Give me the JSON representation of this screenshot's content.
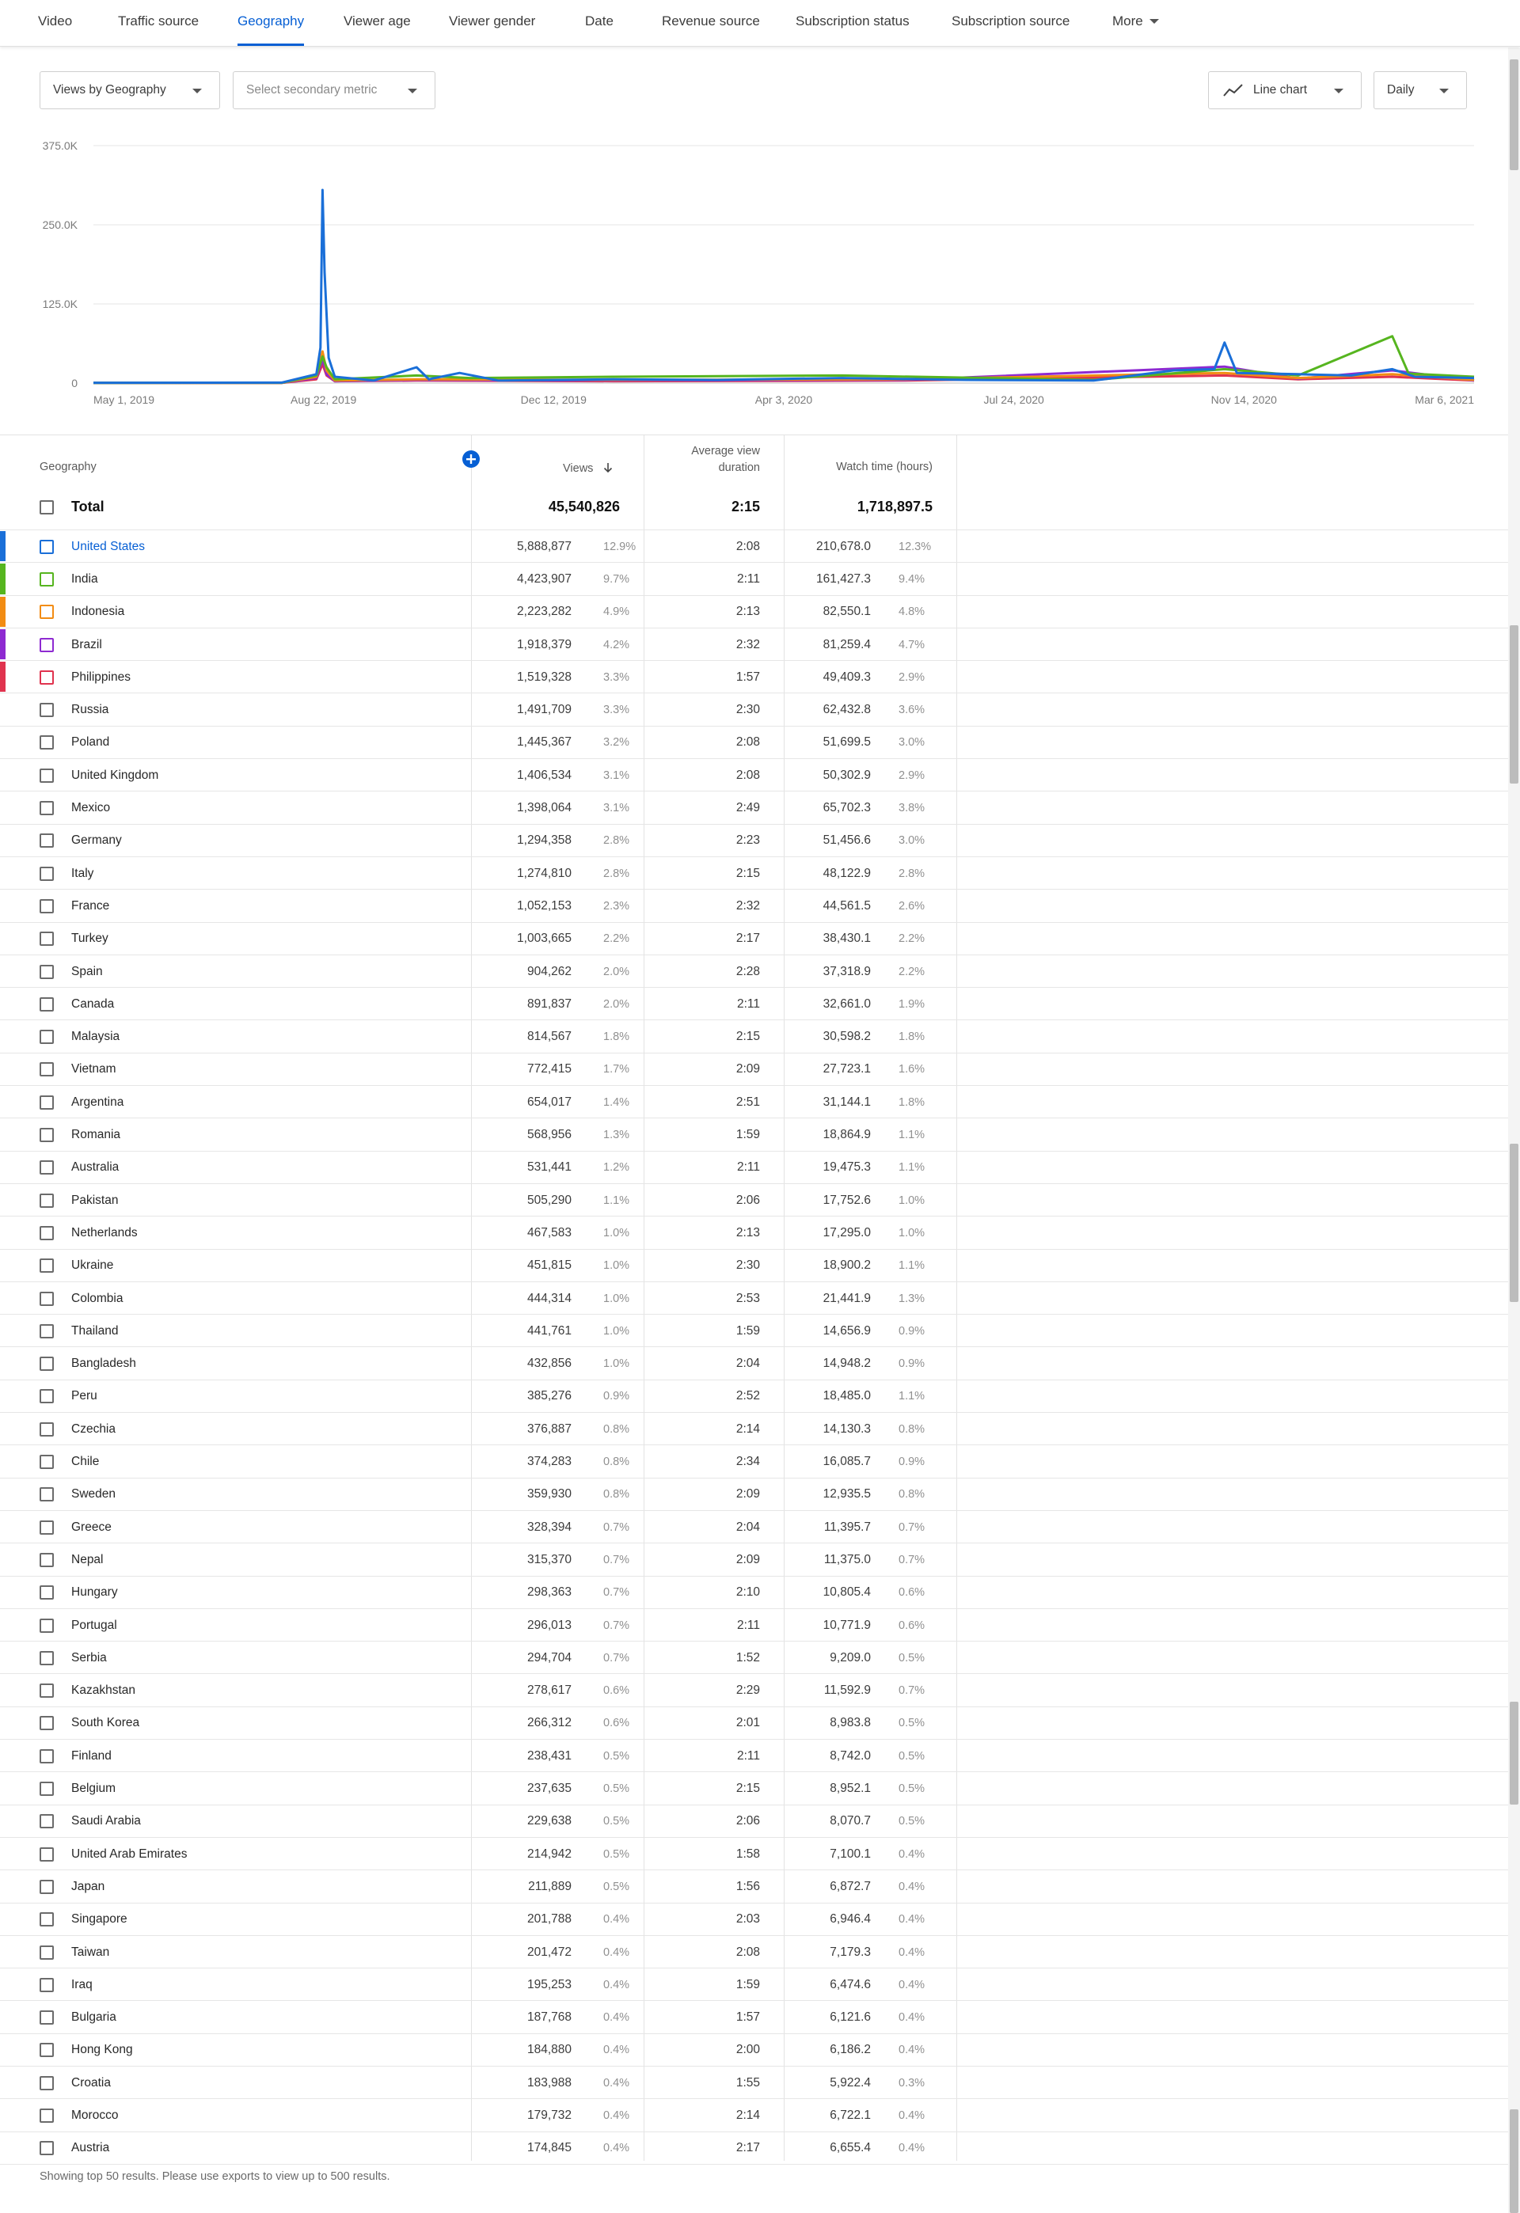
{
  "tabs": [
    {
      "label": "Video",
      "active": false
    },
    {
      "label": "Traffic source",
      "active": false
    },
    {
      "label": "Geography",
      "active": true
    },
    {
      "label": "Viewer age",
      "active": false
    },
    {
      "label": "Viewer gender",
      "active": false
    },
    {
      "label": "Date",
      "active": false
    },
    {
      "label": "Revenue source",
      "active": false
    },
    {
      "label": "Subscription status",
      "active": false
    },
    {
      "label": "Subscription source",
      "active": false
    },
    {
      "label": "More",
      "active": false,
      "icon": "caret-down-icon"
    }
  ],
  "controls": {
    "primary_metric": "Views by Geography",
    "secondary_metric_placeholder": "Select secondary metric",
    "chart_type": "Line chart",
    "chart_type_icon": "line-chart-icon",
    "granularity": "Daily"
  },
  "chart_data": {
    "type": "line",
    "y_ticks": [
      "375.0K",
      "250.0K",
      "125.0K",
      "0"
    ],
    "ylim": [
      0,
      375000
    ],
    "x_ticks": [
      "May 1, 2019",
      "Aug 22, 2019",
      "Dec 12, 2019",
      "Apr 3, 2020",
      "Jul 24, 2020",
      "Nov 14, 2020",
      "Mar 6, 2021"
    ],
    "grid": true,
    "legend": "none",
    "series": [
      {
        "color": "#1a6fd8",
        "points": [
          [
            "2019-05-01",
            500
          ],
          [
            "2019-08-01",
            800
          ],
          [
            "2019-08-18",
            14000
          ],
          [
            "2019-08-20",
            56000
          ],
          [
            "2019-08-21",
            305000
          ],
          [
            "2019-08-22",
            175000
          ],
          [
            "2019-08-24",
            40000
          ],
          [
            "2019-08-27",
            10000
          ],
          [
            "2019-09-15",
            4000
          ],
          [
            "2019-10-06",
            25000
          ],
          [
            "2019-10-12",
            6000
          ],
          [
            "2019-10-27",
            16000
          ],
          [
            "2019-11-15",
            4000
          ],
          [
            "2020-01-10",
            6000
          ],
          [
            "2020-03-01",
            5000
          ],
          [
            "2020-05-01",
            8000
          ],
          [
            "2020-07-01",
            5000
          ],
          [
            "2020-09-01",
            4000
          ],
          [
            "2020-10-10",
            20000
          ],
          [
            "2020-10-30",
            22000
          ],
          [
            "2020-11-04",
            64000
          ],
          [
            "2020-11-10",
            16000
          ],
          [
            "2020-12-10",
            14000
          ],
          [
            "2021-01-05",
            12000
          ],
          [
            "2021-01-25",
            22000
          ],
          [
            "2021-02-05",
            10000
          ],
          [
            "2021-03-06",
            8000
          ]
        ]
      },
      {
        "color": "#56b51f",
        "points": [
          [
            "2019-05-01",
            300
          ],
          [
            "2019-08-01",
            500
          ],
          [
            "2019-08-18",
            12000
          ],
          [
            "2019-08-21",
            42000
          ],
          [
            "2019-08-23",
            25000
          ],
          [
            "2019-08-27",
            6000
          ],
          [
            "2019-10-06",
            12000
          ],
          [
            "2019-11-01",
            8000
          ],
          [
            "2020-01-10",
            10000
          ],
          [
            "2020-05-01",
            12000
          ],
          [
            "2020-09-01",
            5000
          ],
          [
            "2020-11-04",
            22000
          ],
          [
            "2020-12-10",
            12000
          ],
          [
            "2021-01-25",
            74000
          ],
          [
            "2021-02-02",
            15000
          ],
          [
            "2021-03-06",
            10000
          ]
        ]
      },
      {
        "color": "#f28c13",
        "points": [
          [
            "2019-05-01",
            200
          ],
          [
            "2019-08-01",
            300
          ],
          [
            "2019-08-18",
            10000
          ],
          [
            "2019-08-21",
            50000
          ],
          [
            "2019-08-23",
            20000
          ],
          [
            "2019-08-27",
            4000
          ],
          [
            "2019-10-06",
            6000
          ],
          [
            "2020-01-10",
            5000
          ],
          [
            "2020-06-01",
            6000
          ],
          [
            "2020-11-04",
            16000
          ],
          [
            "2020-12-10",
            8000
          ],
          [
            "2021-01-25",
            14000
          ],
          [
            "2021-03-06",
            5000
          ]
        ]
      },
      {
        "color": "#8e2ad1",
        "points": [
          [
            "2019-05-01",
            200
          ],
          [
            "2019-08-01",
            300
          ],
          [
            "2019-08-18",
            8000
          ],
          [
            "2019-08-21",
            38000
          ],
          [
            "2019-08-23",
            14000
          ],
          [
            "2019-08-27",
            3000
          ],
          [
            "2019-10-06",
            5000
          ],
          [
            "2020-01-10",
            4000
          ],
          [
            "2020-06-01",
            5000
          ],
          [
            "2020-11-04",
            26000
          ],
          [
            "2020-12-10",
            7000
          ],
          [
            "2021-01-25",
            20000
          ],
          [
            "2021-03-06",
            4000
          ]
        ]
      },
      {
        "color": "#e0334e",
        "points": [
          [
            "2019-05-01",
            200
          ],
          [
            "2019-08-01",
            300
          ],
          [
            "2019-08-18",
            6000
          ],
          [
            "2019-08-21",
            30000
          ],
          [
            "2019-08-23",
            12000
          ],
          [
            "2019-08-27",
            3000
          ],
          [
            "2019-10-06",
            4000
          ],
          [
            "2020-01-10",
            3000
          ],
          [
            "2020-06-01",
            4000
          ],
          [
            "2020-11-04",
            12000
          ],
          [
            "2020-12-10",
            6000
          ],
          [
            "2021-01-25",
            10000
          ],
          [
            "2021-03-06",
            4000
          ]
        ]
      }
    ]
  },
  "table": {
    "columns": {
      "geography": "Geography",
      "views": "Views",
      "avg_view_duration_line1": "Average view",
      "avg_view_duration_line2": "duration",
      "watch_time": "Watch time (hours)"
    },
    "sort_icon": "arrow-down-icon",
    "add_metric_icon": "plus-circle-icon",
    "total": {
      "label": "Total",
      "views": "45,540,826",
      "avg": "2:15",
      "watch": "1,718,897.5"
    },
    "rows": [
      {
        "name": "United States",
        "views": "5,888,877",
        "views_pct": "12.9%",
        "avg": "2:08",
        "watch": "210,678.0",
        "watch_pct": "12.3%",
        "color": "#1a6fd8",
        "highlight": true
      },
      {
        "name": "India",
        "views": "4,423,907",
        "views_pct": "9.7%",
        "avg": "2:11",
        "watch": "161,427.3",
        "watch_pct": "9.4%",
        "color": "#56b51f"
      },
      {
        "name": "Indonesia",
        "views": "2,223,282",
        "views_pct": "4.9%",
        "avg": "2:13",
        "watch": "82,550.1",
        "watch_pct": "4.8%",
        "color": "#f28c13"
      },
      {
        "name": "Brazil",
        "views": "1,918,379",
        "views_pct": "4.2%",
        "avg": "2:32",
        "watch": "81,259.4",
        "watch_pct": "4.7%",
        "color": "#8e2ad1"
      },
      {
        "name": "Philippines",
        "views": "1,519,328",
        "views_pct": "3.3%",
        "avg": "1:57",
        "watch": "49,409.3",
        "watch_pct": "2.9%",
        "color": "#e0334e"
      },
      {
        "name": "Russia",
        "views": "1,491,709",
        "views_pct": "3.3%",
        "avg": "2:30",
        "watch": "62,432.8",
        "watch_pct": "3.6%"
      },
      {
        "name": "Poland",
        "views": "1,445,367",
        "views_pct": "3.2%",
        "avg": "2:08",
        "watch": "51,699.5",
        "watch_pct": "3.0%"
      },
      {
        "name": "United Kingdom",
        "views": "1,406,534",
        "views_pct": "3.1%",
        "avg": "2:08",
        "watch": "50,302.9",
        "watch_pct": "2.9%"
      },
      {
        "name": "Mexico",
        "views": "1,398,064",
        "views_pct": "3.1%",
        "avg": "2:49",
        "watch": "65,702.3",
        "watch_pct": "3.8%"
      },
      {
        "name": "Germany",
        "views": "1,294,358",
        "views_pct": "2.8%",
        "avg": "2:23",
        "watch": "51,456.6",
        "watch_pct": "3.0%"
      },
      {
        "name": "Italy",
        "views": "1,274,810",
        "views_pct": "2.8%",
        "avg": "2:15",
        "watch": "48,122.9",
        "watch_pct": "2.8%"
      },
      {
        "name": "France",
        "views": "1,052,153",
        "views_pct": "2.3%",
        "avg": "2:32",
        "watch": "44,561.5",
        "watch_pct": "2.6%"
      },
      {
        "name": "Turkey",
        "views": "1,003,665",
        "views_pct": "2.2%",
        "avg": "2:17",
        "watch": "38,430.1",
        "watch_pct": "2.2%"
      },
      {
        "name": "Spain",
        "views": "904,262",
        "views_pct": "2.0%",
        "avg": "2:28",
        "watch": "37,318.9",
        "watch_pct": "2.2%"
      },
      {
        "name": "Canada",
        "views": "891,837",
        "views_pct": "2.0%",
        "avg": "2:11",
        "watch": "32,661.0",
        "watch_pct": "1.9%"
      },
      {
        "name": "Malaysia",
        "views": "814,567",
        "views_pct": "1.8%",
        "avg": "2:15",
        "watch": "30,598.2",
        "watch_pct": "1.8%"
      },
      {
        "name": "Vietnam",
        "views": "772,415",
        "views_pct": "1.7%",
        "avg": "2:09",
        "watch": "27,723.1",
        "watch_pct": "1.6%"
      },
      {
        "name": "Argentina",
        "views": "654,017",
        "views_pct": "1.4%",
        "avg": "2:51",
        "watch": "31,144.1",
        "watch_pct": "1.8%"
      },
      {
        "name": "Romania",
        "views": "568,956",
        "views_pct": "1.3%",
        "avg": "1:59",
        "watch": "18,864.9",
        "watch_pct": "1.1%"
      },
      {
        "name": "Australia",
        "views": "531,441",
        "views_pct": "1.2%",
        "avg": "2:11",
        "watch": "19,475.3",
        "watch_pct": "1.1%"
      },
      {
        "name": "Pakistan",
        "views": "505,290",
        "views_pct": "1.1%",
        "avg": "2:06",
        "watch": "17,752.6",
        "watch_pct": "1.0%"
      },
      {
        "name": "Netherlands",
        "views": "467,583",
        "views_pct": "1.0%",
        "avg": "2:13",
        "watch": "17,295.0",
        "watch_pct": "1.0%"
      },
      {
        "name": "Ukraine",
        "views": "451,815",
        "views_pct": "1.0%",
        "avg": "2:30",
        "watch": "18,900.2",
        "watch_pct": "1.1%"
      },
      {
        "name": "Colombia",
        "views": "444,314",
        "views_pct": "1.0%",
        "avg": "2:53",
        "watch": "21,441.9",
        "watch_pct": "1.3%"
      },
      {
        "name": "Thailand",
        "views": "441,761",
        "views_pct": "1.0%",
        "avg": "1:59",
        "watch": "14,656.9",
        "watch_pct": "0.9%"
      },
      {
        "name": "Bangladesh",
        "views": "432,856",
        "views_pct": "1.0%",
        "avg": "2:04",
        "watch": "14,948.2",
        "watch_pct": "0.9%"
      },
      {
        "name": "Peru",
        "views": "385,276",
        "views_pct": "0.9%",
        "avg": "2:52",
        "watch": "18,485.0",
        "watch_pct": "1.1%"
      },
      {
        "name": "Czechia",
        "views": "376,887",
        "views_pct": "0.8%",
        "avg": "2:14",
        "watch": "14,130.3",
        "watch_pct": "0.8%"
      },
      {
        "name": "Chile",
        "views": "374,283",
        "views_pct": "0.8%",
        "avg": "2:34",
        "watch": "16,085.7",
        "watch_pct": "0.9%"
      },
      {
        "name": "Sweden",
        "views": "359,930",
        "views_pct": "0.8%",
        "avg": "2:09",
        "watch": "12,935.5",
        "watch_pct": "0.8%"
      },
      {
        "name": "Greece",
        "views": "328,394",
        "views_pct": "0.7%",
        "avg": "2:04",
        "watch": "11,395.7",
        "watch_pct": "0.7%"
      },
      {
        "name": "Nepal",
        "views": "315,370",
        "views_pct": "0.7%",
        "avg": "2:09",
        "watch": "11,375.0",
        "watch_pct": "0.7%"
      },
      {
        "name": "Hungary",
        "views": "298,363",
        "views_pct": "0.7%",
        "avg": "2:10",
        "watch": "10,805.4",
        "watch_pct": "0.6%"
      },
      {
        "name": "Portugal",
        "views": "296,013",
        "views_pct": "0.7%",
        "avg": "2:11",
        "watch": "10,771.9",
        "watch_pct": "0.6%"
      },
      {
        "name": "Serbia",
        "views": "294,704",
        "views_pct": "0.7%",
        "avg": "1:52",
        "watch": "9,209.0",
        "watch_pct": "0.5%"
      },
      {
        "name": "Kazakhstan",
        "views": "278,617",
        "views_pct": "0.6%",
        "avg": "2:29",
        "watch": "11,592.9",
        "watch_pct": "0.7%"
      },
      {
        "name": "South Korea",
        "views": "266,312",
        "views_pct": "0.6%",
        "avg": "2:01",
        "watch": "8,983.8",
        "watch_pct": "0.5%"
      },
      {
        "name": "Finland",
        "views": "238,431",
        "views_pct": "0.5%",
        "avg": "2:11",
        "watch": "8,742.0",
        "watch_pct": "0.5%"
      },
      {
        "name": "Belgium",
        "views": "237,635",
        "views_pct": "0.5%",
        "avg": "2:15",
        "watch": "8,952.1",
        "watch_pct": "0.5%"
      },
      {
        "name": "Saudi Arabia",
        "views": "229,638",
        "views_pct": "0.5%",
        "avg": "2:06",
        "watch": "8,070.7",
        "watch_pct": "0.5%"
      },
      {
        "name": "United Arab Emirates",
        "views": "214,942",
        "views_pct": "0.5%",
        "avg": "1:58",
        "watch": "7,100.1",
        "watch_pct": "0.4%"
      },
      {
        "name": "Japan",
        "views": "211,889",
        "views_pct": "0.5%",
        "avg": "1:56",
        "watch": "6,872.7",
        "watch_pct": "0.4%"
      },
      {
        "name": "Singapore",
        "views": "201,788",
        "views_pct": "0.4%",
        "avg": "2:03",
        "watch": "6,946.4",
        "watch_pct": "0.4%"
      },
      {
        "name": "Taiwan",
        "views": "201,472",
        "views_pct": "0.4%",
        "avg": "2:08",
        "watch": "7,179.3",
        "watch_pct": "0.4%"
      },
      {
        "name": "Iraq",
        "views": "195,253",
        "views_pct": "0.4%",
        "avg": "1:59",
        "watch": "6,474.6",
        "watch_pct": "0.4%"
      },
      {
        "name": "Bulgaria",
        "views": "187,768",
        "views_pct": "0.4%",
        "avg": "1:57",
        "watch": "6,121.6",
        "watch_pct": "0.4%"
      },
      {
        "name": "Hong Kong",
        "views": "184,880",
        "views_pct": "0.4%",
        "avg": "2:00",
        "watch": "6,186.2",
        "watch_pct": "0.4%"
      },
      {
        "name": "Croatia",
        "views": "183,988",
        "views_pct": "0.4%",
        "avg": "1:55",
        "watch": "5,922.4",
        "watch_pct": "0.3%"
      },
      {
        "name": "Morocco",
        "views": "179,732",
        "views_pct": "0.4%",
        "avg": "2:14",
        "watch": "6,722.1",
        "watch_pct": "0.4%"
      },
      {
        "name": "Austria",
        "views": "174,845",
        "views_pct": "0.4%",
        "avg": "2:17",
        "watch": "6,655.4",
        "watch_pct": "0.4%"
      }
    ]
  },
  "footer": "Showing top 50 results. Please use exports to view up to 500 results."
}
